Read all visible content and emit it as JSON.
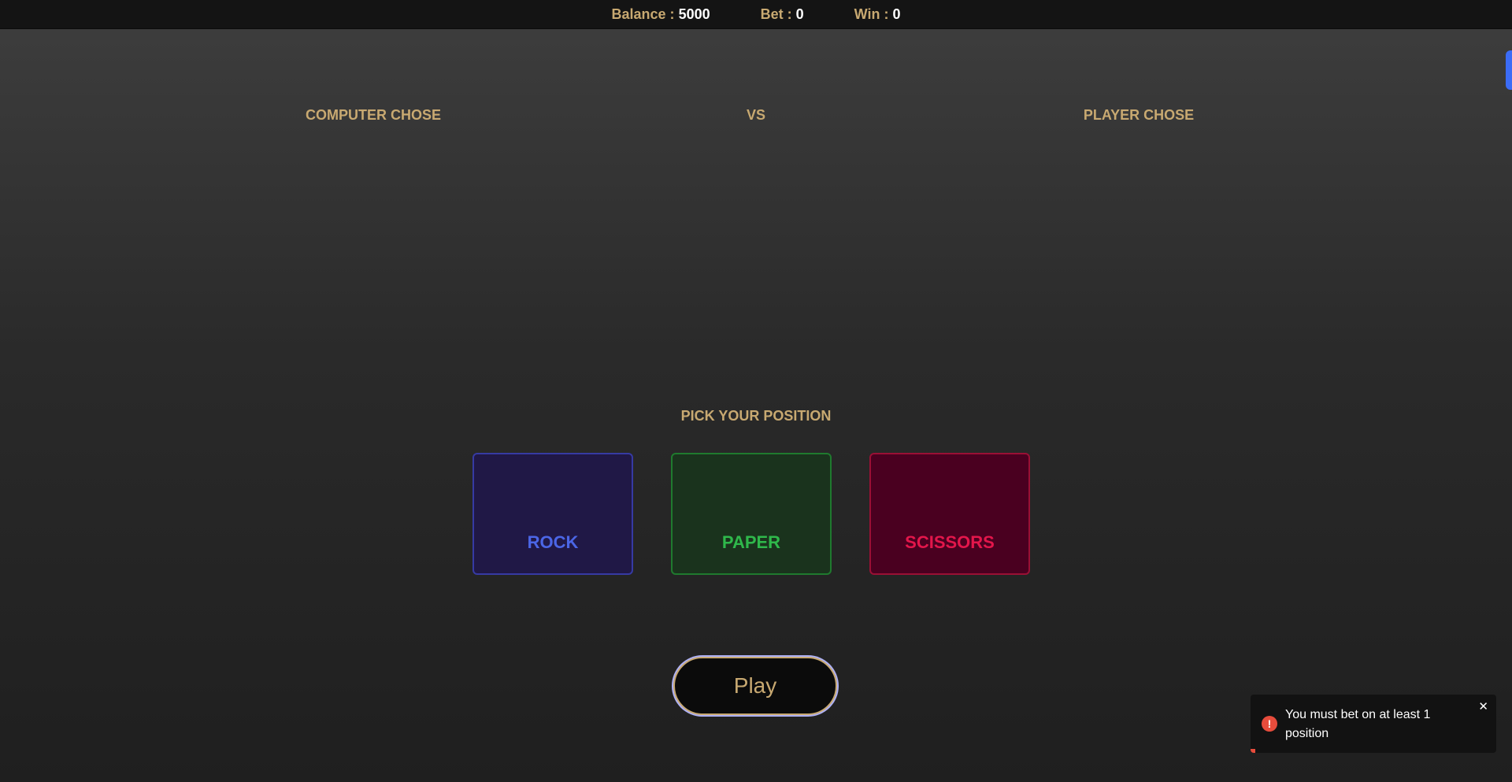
{
  "topbar": {
    "balance_label": "Balance : ",
    "balance_value": "5000",
    "bet_label": "Bet : ",
    "bet_value": "0",
    "win_label": "Win : ",
    "win_value": "0"
  },
  "arena": {
    "computer_label": "COMPUTER CHOSE",
    "vs_label": "VS",
    "player_label": "PLAYER CHOSE"
  },
  "picker": {
    "title": "PICK YOUR POSITION",
    "options": [
      {
        "label": "ROCK",
        "color": "#4b66e6"
      },
      {
        "label": "PAPER",
        "color": "#2fb84b"
      },
      {
        "label": "SCISSORS",
        "color": "#e3164b"
      }
    ]
  },
  "play_label": "Play",
  "toast": {
    "message": "You must bet on at least 1 position",
    "type": "error",
    "icon": "error-icon",
    "close_icon": "close-icon",
    "progress_fraction": 0.02
  },
  "colors": {
    "accent_gold": "#c8a971",
    "side_tab": "#3b6cf6"
  }
}
